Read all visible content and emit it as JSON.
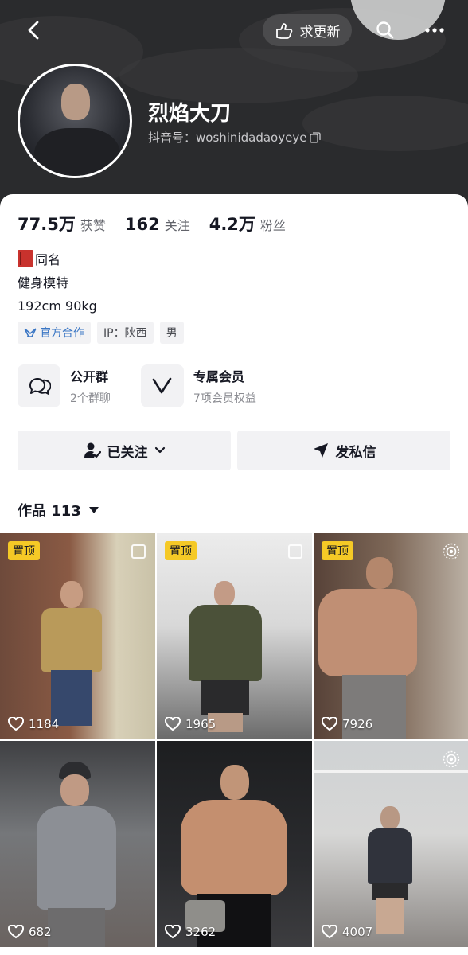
{
  "header": {
    "update_label": "求更新",
    "nickname": "烈焰大刀",
    "douyin_id_label": "抖音号：woshinidadaoyeye"
  },
  "stats": [
    {
      "value": "77.5万",
      "label": "获赞"
    },
    {
      "value": "162",
      "label": "关注"
    },
    {
      "value": "4.2万",
      "label": "粉丝"
    }
  ],
  "bio": {
    "line1": "同名",
    "line2": "健身模特",
    "line3": "192cm 90kg"
  },
  "tags": {
    "official": "官方合作",
    "ip": "IP：陕西",
    "gender": "男"
  },
  "entries": {
    "group": {
      "title": "公开群",
      "subtitle": "2个群聊"
    },
    "member": {
      "title": "专属会员",
      "subtitle": "7项会员权益"
    }
  },
  "actions": {
    "followed": "已关注",
    "message": "发私信"
  },
  "works": {
    "label": "作品 113"
  },
  "pinned_label": "置顶",
  "videos": [
    {
      "likes": "1184",
      "pinned": true
    },
    {
      "likes": "1965",
      "pinned": true
    },
    {
      "likes": "7926",
      "pinned": true
    },
    {
      "likes": "682",
      "pinned": false
    },
    {
      "likes": "3262",
      "pinned": false
    },
    {
      "likes": "4007",
      "pinned": false
    }
  ],
  "colors": {
    "header_bg": "#2a2b2d",
    "pin_badge": "#f5c926",
    "official_tag": "#3a76c4"
  }
}
